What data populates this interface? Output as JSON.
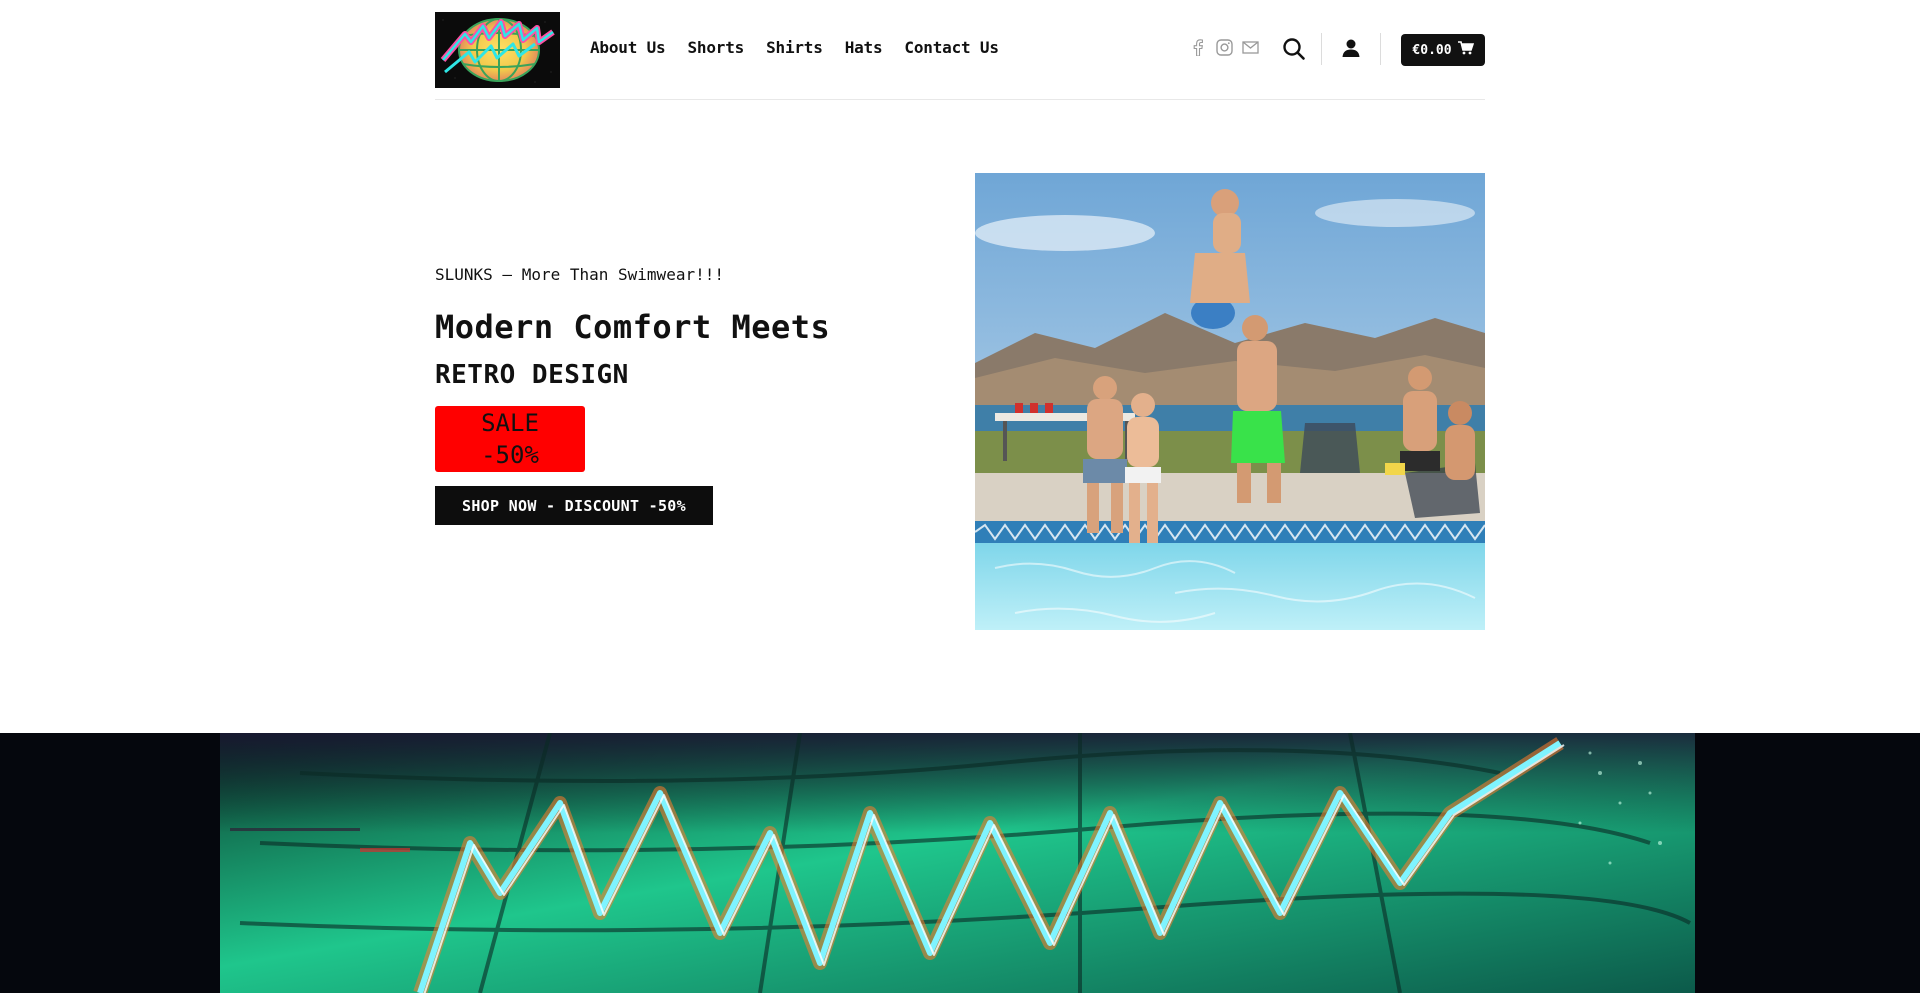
{
  "brand": {
    "logo_text": "SLUNKS"
  },
  "nav": {
    "items": [
      "About Us",
      "Shorts",
      "Shirts",
      "Hats",
      "Contact Us"
    ]
  },
  "header_icons": {
    "social": [
      "facebook-icon",
      "instagram-icon",
      "email-icon"
    ],
    "search": "search-icon",
    "account": "user-icon",
    "cart_icon": "cart-icon"
  },
  "cart": {
    "total": "€0.00"
  },
  "hero": {
    "subtitle": "SLUNKS – More Than Swimwear!!!",
    "title": "Modern Comfort Meets",
    "title2": "RETRO DESIGN",
    "sale_line1": "SALE",
    "sale_line2": "-50%",
    "cta": "SHOP NOW - DISCOUNT -50%"
  },
  "colors": {
    "sale": "#ff0000",
    "button": "#0d0d0d",
    "accent_teal": "#1fe0b0"
  }
}
